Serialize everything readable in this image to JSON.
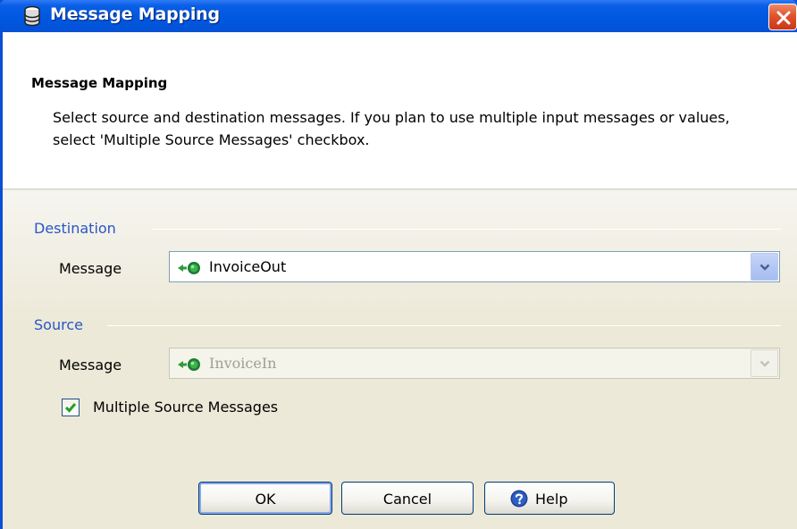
{
  "window": {
    "title": "Message Mapping",
    "icon": "database-icon"
  },
  "banner": {
    "title": "Message Mapping",
    "description": "Select source and destination messages. If you plan to use multiple input messages or values, select 'Multiple Source Messages' checkbox."
  },
  "destination": {
    "section_label": "Destination",
    "message_label": "Message",
    "selected_value": "InvoiceOut",
    "enabled": true
  },
  "source": {
    "section_label": "Source",
    "message_label": "Message",
    "selected_value": "InvoiceIn",
    "enabled": false
  },
  "multiple_source": {
    "label": "Multiple Source Messages",
    "checked": true
  },
  "buttons": {
    "ok_label": "OK",
    "cancel_label": "Cancel",
    "help_label": "Help"
  },
  "colors": {
    "titlebar": "#0058e0",
    "section_heading": "#2a56c6",
    "close_button": "#e0532c"
  }
}
